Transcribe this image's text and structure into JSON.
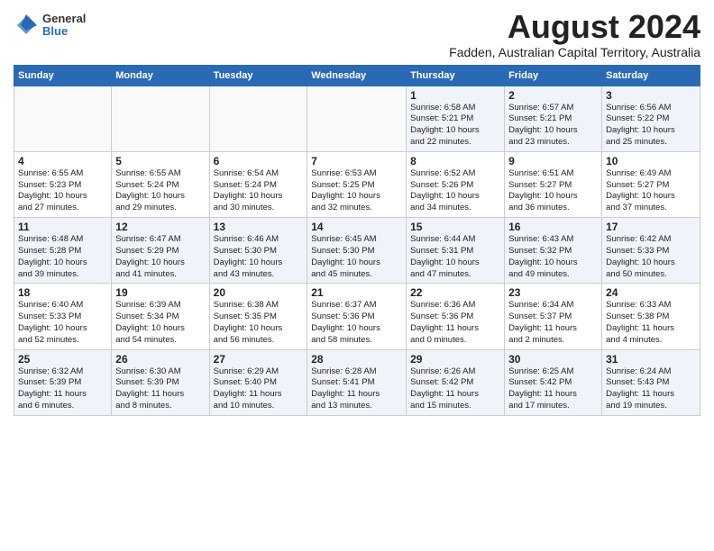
{
  "header": {
    "logo": {
      "general": "General",
      "blue": "Blue"
    },
    "title": "August 2024",
    "subtitle": "Fadden, Australian Capital Territory, Australia"
  },
  "days_of_week": [
    "Sunday",
    "Monday",
    "Tuesday",
    "Wednesday",
    "Thursday",
    "Friday",
    "Saturday"
  ],
  "weeks": [
    [
      {
        "day": "",
        "info": ""
      },
      {
        "day": "",
        "info": ""
      },
      {
        "day": "",
        "info": ""
      },
      {
        "day": "",
        "info": ""
      },
      {
        "day": "1",
        "info": "Sunrise: 6:58 AM\nSunset: 5:21 PM\nDaylight: 10 hours\nand 22 minutes."
      },
      {
        "day": "2",
        "info": "Sunrise: 6:57 AM\nSunset: 5:21 PM\nDaylight: 10 hours\nand 23 minutes."
      },
      {
        "day": "3",
        "info": "Sunrise: 6:56 AM\nSunset: 5:22 PM\nDaylight: 10 hours\nand 25 minutes."
      }
    ],
    [
      {
        "day": "4",
        "info": "Sunrise: 6:55 AM\nSunset: 5:23 PM\nDaylight: 10 hours\nand 27 minutes."
      },
      {
        "day": "5",
        "info": "Sunrise: 6:55 AM\nSunset: 5:24 PM\nDaylight: 10 hours\nand 29 minutes."
      },
      {
        "day": "6",
        "info": "Sunrise: 6:54 AM\nSunset: 5:24 PM\nDaylight: 10 hours\nand 30 minutes."
      },
      {
        "day": "7",
        "info": "Sunrise: 6:53 AM\nSunset: 5:25 PM\nDaylight: 10 hours\nand 32 minutes."
      },
      {
        "day": "8",
        "info": "Sunrise: 6:52 AM\nSunset: 5:26 PM\nDaylight: 10 hours\nand 34 minutes."
      },
      {
        "day": "9",
        "info": "Sunrise: 6:51 AM\nSunset: 5:27 PM\nDaylight: 10 hours\nand 36 minutes."
      },
      {
        "day": "10",
        "info": "Sunrise: 6:49 AM\nSunset: 5:27 PM\nDaylight: 10 hours\nand 37 minutes."
      }
    ],
    [
      {
        "day": "11",
        "info": "Sunrise: 6:48 AM\nSunset: 5:28 PM\nDaylight: 10 hours\nand 39 minutes."
      },
      {
        "day": "12",
        "info": "Sunrise: 6:47 AM\nSunset: 5:29 PM\nDaylight: 10 hours\nand 41 minutes."
      },
      {
        "day": "13",
        "info": "Sunrise: 6:46 AM\nSunset: 5:30 PM\nDaylight: 10 hours\nand 43 minutes."
      },
      {
        "day": "14",
        "info": "Sunrise: 6:45 AM\nSunset: 5:30 PM\nDaylight: 10 hours\nand 45 minutes."
      },
      {
        "day": "15",
        "info": "Sunrise: 6:44 AM\nSunset: 5:31 PM\nDaylight: 10 hours\nand 47 minutes."
      },
      {
        "day": "16",
        "info": "Sunrise: 6:43 AM\nSunset: 5:32 PM\nDaylight: 10 hours\nand 49 minutes."
      },
      {
        "day": "17",
        "info": "Sunrise: 6:42 AM\nSunset: 5:33 PM\nDaylight: 10 hours\nand 50 minutes."
      }
    ],
    [
      {
        "day": "18",
        "info": "Sunrise: 6:40 AM\nSunset: 5:33 PM\nDaylight: 10 hours\nand 52 minutes."
      },
      {
        "day": "19",
        "info": "Sunrise: 6:39 AM\nSunset: 5:34 PM\nDaylight: 10 hours\nand 54 minutes."
      },
      {
        "day": "20",
        "info": "Sunrise: 6:38 AM\nSunset: 5:35 PM\nDaylight: 10 hours\nand 56 minutes."
      },
      {
        "day": "21",
        "info": "Sunrise: 6:37 AM\nSunset: 5:36 PM\nDaylight: 10 hours\nand 58 minutes."
      },
      {
        "day": "22",
        "info": "Sunrise: 6:36 AM\nSunset: 5:36 PM\nDaylight: 11 hours\nand 0 minutes."
      },
      {
        "day": "23",
        "info": "Sunrise: 6:34 AM\nSunset: 5:37 PM\nDaylight: 11 hours\nand 2 minutes."
      },
      {
        "day": "24",
        "info": "Sunrise: 6:33 AM\nSunset: 5:38 PM\nDaylight: 11 hours\nand 4 minutes."
      }
    ],
    [
      {
        "day": "25",
        "info": "Sunrise: 6:32 AM\nSunset: 5:39 PM\nDaylight: 11 hours\nand 6 minutes."
      },
      {
        "day": "26",
        "info": "Sunrise: 6:30 AM\nSunset: 5:39 PM\nDaylight: 11 hours\nand 8 minutes."
      },
      {
        "day": "27",
        "info": "Sunrise: 6:29 AM\nSunset: 5:40 PM\nDaylight: 11 hours\nand 10 minutes."
      },
      {
        "day": "28",
        "info": "Sunrise: 6:28 AM\nSunset: 5:41 PM\nDaylight: 11 hours\nand 13 minutes."
      },
      {
        "day": "29",
        "info": "Sunrise: 6:26 AM\nSunset: 5:42 PM\nDaylight: 11 hours\nand 15 minutes."
      },
      {
        "day": "30",
        "info": "Sunrise: 6:25 AM\nSunset: 5:42 PM\nDaylight: 11 hours\nand 17 minutes."
      },
      {
        "day": "31",
        "info": "Sunrise: 6:24 AM\nSunset: 5:43 PM\nDaylight: 11 hours\nand 19 minutes."
      }
    ]
  ]
}
